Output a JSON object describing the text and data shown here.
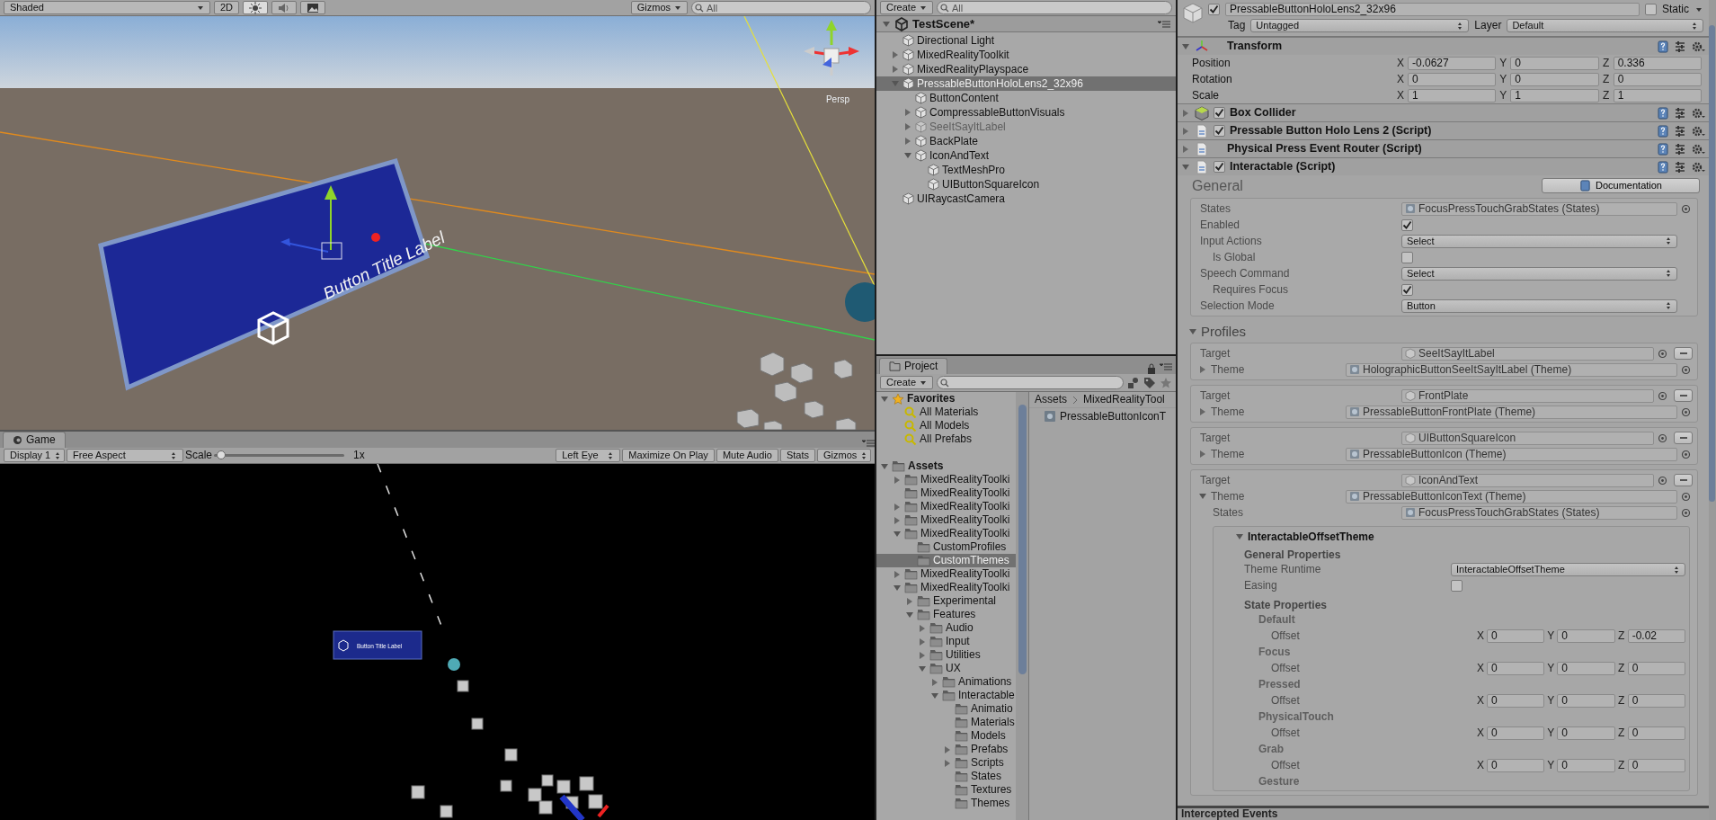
{
  "scene_view": {
    "toolbar": {
      "shading": "Shaded",
      "mode_2d": "2D",
      "toggles": [
        {
          "kind": "light",
          "on": true
        },
        {
          "kind": "audio",
          "on": false
        },
        {
          "kind": "effects",
          "on": false
        }
      ],
      "gizmos": "Gizmos",
      "search_placeholder": "All"
    },
    "projection": "Persp",
    "panel_label": "Button Title Label"
  },
  "game_view": {
    "tab": "Game",
    "toolbar": {
      "display": "Display 1",
      "aspect": "Free Aspect",
      "scale_label": "Scale",
      "scale": {
        "level": 0.02
      },
      "scale_value": "1x",
      "eye": "Left Eye",
      "toggles": [
        "Maximize On Play",
        "Mute Audio",
        "Stats"
      ],
      "gizmos": "Gizmos"
    },
    "button_label": "Button Title Label"
  },
  "hierarchy": {
    "create": "Create",
    "search_placeholder": "All",
    "scene": "TestScene*",
    "items": [
      {
        "name": "Directional Light",
        "selected": false,
        "active": true
      },
      {
        "name": "MixedRealityToolkit",
        "expanded": false,
        "selected": false,
        "active": true
      },
      {
        "name": "MixedRealityPlayspace",
        "expanded": false,
        "selected": false,
        "active": true
      },
      {
        "name": "PressableButtonHoloLens2_32x96",
        "expanded": true,
        "selected": true,
        "active": true,
        "children": [
          {
            "name": "ButtonContent",
            "selected": false,
            "active": true
          },
          {
            "name": "CompressableButtonVisuals",
            "expanded": false,
            "selected": false,
            "active": true
          },
          {
            "name": "SeeItSayItLabel",
            "expanded": false,
            "selected": false,
            "active": false
          },
          {
            "name": "BackPlate",
            "expanded": false,
            "selected": false,
            "active": true
          },
          {
            "name": "IconAndText",
            "expanded": true,
            "selected": false,
            "active": true,
            "children": [
              {
                "name": "TextMeshPro",
                "selected": false,
                "active": true
              },
              {
                "name": "UIButtonSquareIcon",
                "selected": false,
                "active": true
              }
            ]
          }
        ]
      },
      {
        "name": "UIRaycastCamera",
        "selected": false,
        "active": true
      }
    ]
  },
  "project": {
    "tab": "Project",
    "create": "Create",
    "tree": [
      {
        "kind": "favorites",
        "name": "Favorites",
        "expanded": true,
        "selected": false,
        "children": [
          {
            "kind": "search",
            "name": "All Materials",
            "selected": false
          },
          {
            "kind": "search",
            "name": "All Models",
            "selected": false
          },
          {
            "kind": "search",
            "name": "All Prefabs",
            "selected": false
          }
        ]
      },
      {
        "kind": "root",
        "name": "Assets",
        "expanded": true,
        "selected": false,
        "children": [
          {
            "kind": "folder",
            "name": "MixedRealityToolki",
            "expanded": false,
            "selected": false
          },
          {
            "kind": "folder",
            "name": "MixedRealityToolki",
            "selected": false
          },
          {
            "kind": "folder",
            "name": "MixedRealityToolki",
            "expanded": false,
            "selected": false
          },
          {
            "kind": "folder",
            "name": "MixedRealityToolki",
            "expanded": false,
            "selected": false
          },
          {
            "kind": "folder",
            "name": "MixedRealityToolki",
            "expanded": true,
            "selected": false,
            "children": [
              {
                "kind": "folder",
                "name": "CustomProfiles",
                "selected": false
              },
              {
                "kind": "folder",
                "name": "CustomThemes",
                "selected": true
              }
            ]
          },
          {
            "kind": "folder",
            "name": "MixedRealityToolki",
            "expanded": false,
            "selected": false
          },
          {
            "kind": "folder",
            "name": "MixedRealityToolki",
            "expanded": true,
            "selected": false,
            "children": [
              {
                "kind": "folder",
                "name": "Experimental",
                "expanded": false,
                "selected": false
              },
              {
                "kind": "folder",
                "name": "Features",
                "expanded": true,
                "selected": false,
                "children": [
                  {
                    "kind": "folder",
                    "name": "Audio",
                    "expanded": false,
                    "selected": false
                  },
                  {
                    "kind": "folder",
                    "name": "Input",
                    "expanded": false,
                    "selected": false
                  },
                  {
                    "kind": "folder",
                    "name": "Utilities",
                    "expanded": false,
                    "selected": false
                  },
                  {
                    "kind": "folder",
                    "name": "UX",
                    "expanded": true,
                    "selected": false,
                    "children": [
                      {
                        "kind": "folder",
                        "name": "Animations",
                        "expanded": false,
                        "selected": false
                      },
                      {
                        "kind": "folder",
                        "name": "Interactable",
                        "expanded": true,
                        "selected": false,
                        "children": [
                          {
                            "kind": "folder",
                            "name": "Animatio",
                            "selected": false
                          },
                          {
                            "kind": "folder",
                            "name": "Materials",
                            "selected": false
                          },
                          {
                            "kind": "folder",
                            "name": "Models",
                            "selected": false
                          },
                          {
                            "kind": "folder",
                            "name": "Prefabs",
                            "expanded": false,
                            "selected": false
                          },
                          {
                            "kind": "folder",
                            "name": "Scripts",
                            "expanded": false,
                            "selected": false
                          },
                          {
                            "kind": "folder",
                            "name": "States",
                            "selected": false
                          },
                          {
                            "kind": "folder",
                            "name": "Textures",
                            "selected": false
                          },
                          {
                            "kind": "folder",
                            "name": "Themes",
                            "selected": false
                          }
                        ]
                      }
                    ]
                  }
                ]
              }
            ]
          }
        ]
      }
    ],
    "breadcrumb": [
      "Assets",
      "MixedRealityTool"
    ],
    "files": [
      "PressableButtonIconT"
    ]
  },
  "inspector": {
    "object": {
      "active": true,
      "name": "PressableButtonHoloLens2_32x96",
      "static_label": "Static",
      "static": false,
      "tag_label": "Tag",
      "tag": "Untagged",
      "layer_label": "Layer",
      "layer": "Default"
    },
    "transform": {
      "title": "Transform",
      "expanded": true,
      "rows": [
        {
          "label": "Position",
          "values": [
            {
              "axis": "X",
              "value": "-0.0627"
            },
            {
              "axis": "Y",
              "value": "0"
            },
            {
              "axis": "Z",
              "value": "0.336"
            }
          ]
        },
        {
          "label": "Rotation",
          "values": [
            {
              "axis": "X",
              "value": "0"
            },
            {
              "axis": "Y",
              "value": "0"
            },
            {
              "axis": "Z",
              "value": "0"
            }
          ]
        },
        {
          "label": "Scale",
          "values": [
            {
              "axis": "X",
              "value": "1"
            },
            {
              "axis": "Y",
              "value": "1"
            },
            {
              "axis": "Z",
              "value": "1"
            }
          ]
        }
      ]
    },
    "components": [
      {
        "kind": "collider",
        "title": "Box Collider",
        "expanded": false,
        "enabled": true
      },
      {
        "kind": "script",
        "title": "Pressable Button Holo Lens 2 (Script)",
        "expanded": false,
        "enabled": true
      },
      {
        "kind": "script",
        "title": "Physical Press Event Router (Script)",
        "expanded": false
      }
    ],
    "interactable": {
      "kind": "script",
      "title": "Interactable (Script)",
      "expanded": true,
      "enabled": true,
      "general_heading": "General",
      "doc_button": "Documentation",
      "fields": [
        {
          "kind": "object",
          "label": "States",
          "value": "FocusPressTouchGrabStates (States)"
        },
        {
          "kind": "checkbox",
          "label": "Enabled",
          "checked": true
        },
        {
          "kind": "dropdown",
          "label": "Input Actions",
          "value": "Select",
          "children": [
            {
              "kind": "checkbox",
              "label": "Is Global",
              "checked": false
            }
          ]
        },
        {
          "kind": "dropdown",
          "label": "Speech Command",
          "value": "Select",
          "children": [
            {
              "kind": "checkbox",
              "label": "Requires Focus",
              "checked": true
            }
          ]
        },
        {
          "kind": "dropdown",
          "label": "Selection Mode",
          "value": "Button"
        }
      ],
      "profiles_heading": "Profiles",
      "profiles_expanded": true,
      "profiles": [
        {
          "target_label": "Target",
          "target": "SeeItSayItLabel",
          "theme_label": "Theme",
          "theme": "HolographicButtonSeeItSayItLabel (Theme)",
          "expanded": false
        },
        {
          "target_label": "Target",
          "target": "FrontPlate",
          "theme_label": "Theme",
          "theme": "PressableButtonFrontPlate (Theme)",
          "expanded": false
        },
        {
          "target_label": "Target",
          "target": "UIButtonSquareIcon",
          "theme_label": "Theme",
          "theme": "PressableButtonIcon (Theme)",
          "expanded": false
        },
        {
          "target_label": "Target",
          "target": "IconAndText",
          "theme_label": "Theme",
          "theme": "PressableButtonIconText (Theme)",
          "expanded": true,
          "states_label": "States",
          "states": "FocusPressTouchGrabStates (States)",
          "theme_detail": {
            "title": "InteractableOffsetTheme",
            "expanded": true,
            "general_heading": "General Properties",
            "runtime_label": "Theme Runtime",
            "runtime": "InteractableOffsetTheme",
            "easing_label": "Easing",
            "easing": false,
            "state_heading": "State Properties",
            "states": [
              {
                "name": "Default",
                "property": "Offset",
                "values": [
                  {
                    "axis": "X",
                    "value": "0"
                  },
                  {
                    "axis": "Y",
                    "value": "0"
                  },
                  {
                    "axis": "Z",
                    "value": "-0.02"
                  }
                ]
              },
              {
                "name": "Focus",
                "property": "Offset",
                "values": [
                  {
                    "axis": "X",
                    "value": "0"
                  },
                  {
                    "axis": "Y",
                    "value": "0"
                  },
                  {
                    "axis": "Z",
                    "value": "0"
                  }
                ]
              },
              {
                "name": "Pressed",
                "property": "Offset",
                "values": [
                  {
                    "axis": "X",
                    "value": "0"
                  },
                  {
                    "axis": "Y",
                    "value": "0"
                  },
                  {
                    "axis": "Z",
                    "value": "0"
                  }
                ]
              },
              {
                "name": "PhysicalTouch",
                "property": "Offset",
                "values": [
                  {
                    "axis": "X",
                    "value": "0"
                  },
                  {
                    "axis": "Y",
                    "value": "0"
                  },
                  {
                    "axis": "Z",
                    "value": "0"
                  }
                ]
              },
              {
                "name": "Grab",
                "property": "Offset",
                "values": [
                  {
                    "axis": "X",
                    "value": "0"
                  },
                  {
                    "axis": "Y",
                    "value": "0"
                  },
                  {
                    "axis": "Z",
                    "value": "0"
                  }
                ]
              },
              {
                "name": "Gesture"
              }
            ]
          }
        }
      ],
      "events_heading": "Intercepted Events"
    }
  }
}
